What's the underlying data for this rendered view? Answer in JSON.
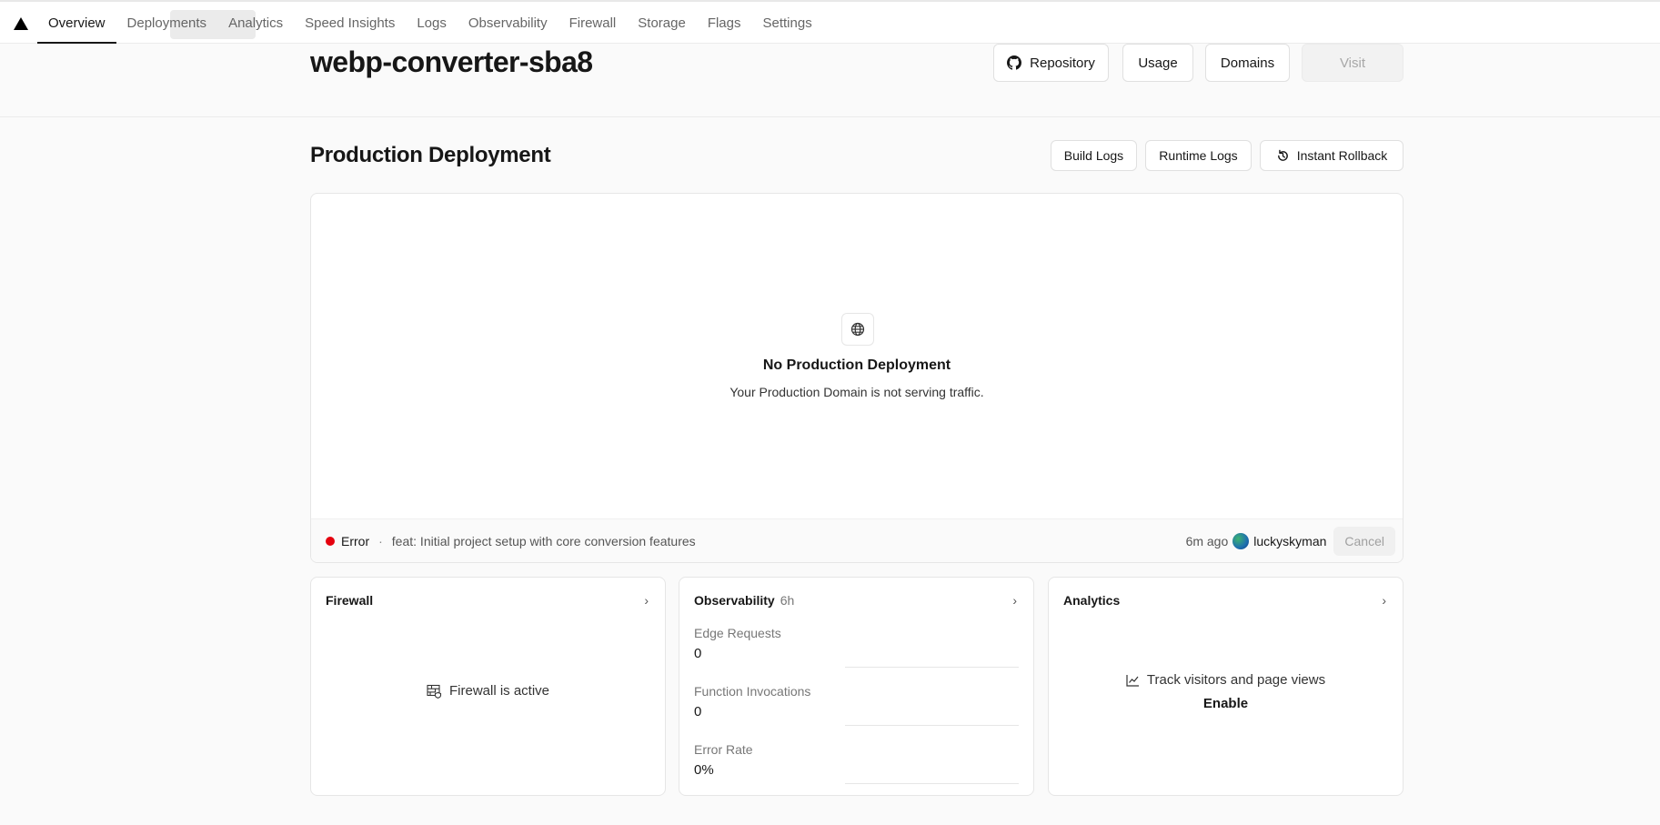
{
  "nav": {
    "tabs": [
      "Overview",
      "Deployments",
      "Analytics",
      "Speed Insights",
      "Logs",
      "Observability",
      "Firewall",
      "Storage",
      "Flags",
      "Settings"
    ],
    "active": "Overview"
  },
  "header": {
    "project_name": "webp-converter-sba8",
    "repository_label": "Repository",
    "usage_label": "Usage",
    "domains_label": "Domains",
    "visit_label": "Visit"
  },
  "production": {
    "title": "Production Deployment",
    "build_logs_label": "Build Logs",
    "runtime_logs_label": "Runtime Logs",
    "rollback_label": "Instant Rollback",
    "empty_title": "No Production Deployment",
    "empty_subtitle": "Your Production Domain is not serving traffic.",
    "status": "Error",
    "separator": "·",
    "commit_message": "feat: Initial project setup with core conversion features",
    "time_ago": "6m ago",
    "author": "luckyskyman",
    "cancel_label": "Cancel",
    "status_color": "#e5000e"
  },
  "firewall": {
    "title": "Firewall",
    "status_text": "Firewall is active"
  },
  "observability": {
    "title": "Observability",
    "period": "6h",
    "metrics": [
      {
        "label": "Edge Requests",
        "value": "0"
      },
      {
        "label": "Function Invocations",
        "value": "0"
      },
      {
        "label": "Error Rate",
        "value": "0%"
      }
    ]
  },
  "analytics": {
    "title": "Analytics",
    "description": "Track visitors and page views",
    "enable_label": "Enable"
  },
  "icons": {
    "logo": "triangle-logo-icon",
    "repository": "github-icon",
    "rollback": "rollback-icon",
    "empty_state": "globe-icon",
    "firewall": "firewall-icon",
    "analytics": "line-chart-icon",
    "chevron": "chevron-right-icon"
  }
}
